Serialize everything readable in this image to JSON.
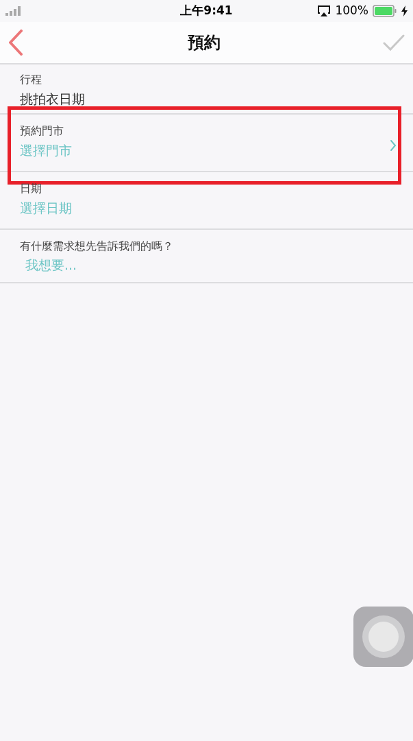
{
  "status_bar": {
    "time": "上午9:41",
    "battery": "100%"
  },
  "nav": {
    "title": "預約"
  },
  "rows": [
    {
      "kind": "text",
      "label": "行程",
      "value": "挑拍衣日期",
      "chevron": false,
      "highlighted": false
    },
    {
      "kind": "picker",
      "label": "預約門市",
      "value": "選擇門市",
      "chevron": true,
      "highlighted": true
    },
    {
      "kind": "picker",
      "label": "日期",
      "value": "選擇日期",
      "chevron": false,
      "highlighted": false
    },
    {
      "kind": "input",
      "label": "有什麼需求想先告訴我們的嗎？",
      "placeholder": "我想要...",
      "chevron": false,
      "highlighted": false
    }
  ]
}
